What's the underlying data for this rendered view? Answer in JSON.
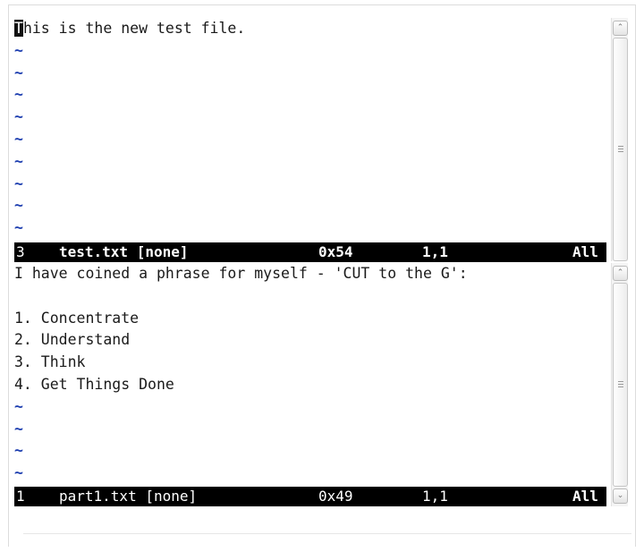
{
  "top_pane": {
    "cursor_char": "T",
    "first_line_rest": "his is the new test file.",
    "tilde": "~",
    "status": {
      "buffer_number": "3",
      "filename": "test.txt [none]",
      "char_code": "0x54",
      "position": "1,1",
      "scroll_pct": "All"
    }
  },
  "bottom_pane": {
    "lines": [
      "I have coined a phrase for myself - 'CUT to the G':",
      "",
      "1. Concentrate",
      "2. Understand",
      "3. Think",
      "4. Get Things Done"
    ],
    "tilde": "~",
    "status": {
      "buffer_number": "1",
      "filename": "part1.txt [none]",
      "char_code": "0x49",
      "position": "1,1",
      "scroll_pct": "All"
    }
  },
  "scrollbar": {
    "up_arrow": "⌃",
    "down_arrow": "⌄"
  }
}
